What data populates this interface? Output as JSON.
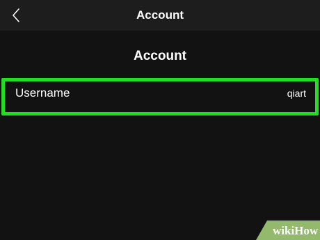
{
  "header": {
    "title": "Account",
    "back_icon": "chevron-left-icon"
  },
  "page": {
    "heading": "Account"
  },
  "rows": [
    {
      "label": "Username",
      "value": "qiart"
    }
  ],
  "highlight": {
    "color": "#22dd22"
  },
  "watermark": {
    "text": "wikiHow"
  }
}
